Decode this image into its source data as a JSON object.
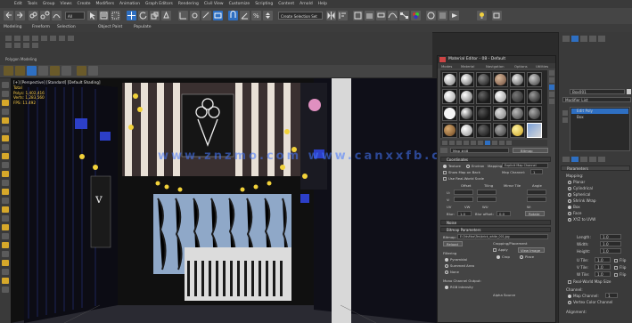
{
  "menubar": {
    "items": [
      "Edit",
      "Tools",
      "Group",
      "Views",
      "Create",
      "Modifiers",
      "Animation",
      "Graph Editors",
      "Rendering",
      "Civil View",
      "Customize",
      "Scripting",
      "Content",
      "Arnold",
      "Help"
    ]
  },
  "toolbar": {
    "filter_value": "All",
    "selection_set_value": "Create Selection Set"
  },
  "ribbon": {
    "tabs": [
      "Modeling",
      "Freeform",
      "Selection",
      "Object Paint",
      "Populate"
    ],
    "sub_label": "Polygon Modeling"
  },
  "viewport": {
    "label": "[+] [Perspective] [Standard] [Default Shading]",
    "stats_label": "Total",
    "stats_polys": "Polys: 1,402,416",
    "stats_verts": "Verts: 1,283,560",
    "fps": "FPS: 11.492",
    "watermark": "www.znzmo.com  www.canxxfb.com"
  },
  "material_editor": {
    "title": "Material Editor - 08 - Default",
    "menu": [
      "Modes",
      "Material",
      "Navigation",
      "Options",
      "Utilities"
    ],
    "material_name": "Map #48",
    "material_type": "Bitmap",
    "rollout_coordinates": "Coordinates",
    "texture_label": "Texture",
    "environ_label": "Environ",
    "mapping_label": "Mapping:",
    "mapping_value": "Explicit Map Channel",
    "map_channel_label": "Map Channel:",
    "map_channel_value": "1",
    "real_world_label": "Use Real-World Scale",
    "show_map_label": "Show Map on Back",
    "offset_label": "Offset",
    "tiling_label": "Tiling",
    "mirror_tile_label": "Mirror Tile",
    "angle_label": "Angle",
    "u_label": "U:",
    "v_label": "V:",
    "w_label": "W:",
    "uv_label": "UV",
    "vw_label": "VW",
    "wu_label": "WU",
    "blur_label": "Blur:",
    "blur_value": "1.0",
    "blur_offset_label": "Blur offset:",
    "blur_offset_value": "0.0",
    "rotate_label": "Rotate",
    "noise_label": "Noise",
    "bitmap_params_label": "Bitmap Parameters",
    "bitmap_label": "Bitmap:",
    "bitmap_path": "E:\\3dsMax\\Tex\\brick_white_001.jpg",
    "reload_label": "Reload",
    "cropping_label": "Cropping/Placement",
    "apply_label": "Apply",
    "view_image_label": "View Image",
    "crop_label": "Crop",
    "place_label": "Place",
    "filtering_label": "Filtering",
    "pyramidal_label": "Pyramidal",
    "summed_area_label": "Summed Area",
    "none_label": "None",
    "mono_channel_label": "Mono Channel Output:",
    "rgb_intensity_label": "RGB Intensity",
    "alpha_source_label": "Alpha Source"
  },
  "command_panel": {
    "object_name": "Box001",
    "modifier_list": "Modifier List",
    "stack_item": "Edit Poly",
    "stack_item2": "Box",
    "parameters_label": "Parameters",
    "mapping_label": "Mapping:",
    "options": [
      "Planar",
      "Cylindrical",
      "Spherical",
      "Shrink Wrap",
      "Box",
      "Face",
      "XYZ to UVW"
    ],
    "selected_option": "Box",
    "length_label": "Length:",
    "width_label": "Width:",
    "height_label": "Height:",
    "length_value": "1.0",
    "width_value": "1.0",
    "height_value": "1.0",
    "u_tile_label": "U Tile:",
    "v_tile_label": "V Tile:",
    "w_tile_label": "W Tile:",
    "u_tile_value": "1.0",
    "v_tile_value": "1.0",
    "w_tile_value": "1.0",
    "flip_label": "Flip",
    "real_world_label": "Real-World Map Size",
    "channel_label": "Channel:",
    "map_channel_label": "Map Channel:",
    "map_channel_value": "1",
    "vertex_color_label": "Vertex Color Channel",
    "alignment_label": "Alignment:"
  },
  "colors": {
    "accent": "#2e6fc2",
    "yellow": "#d6a82a",
    "panel": "#3a3a3a"
  }
}
